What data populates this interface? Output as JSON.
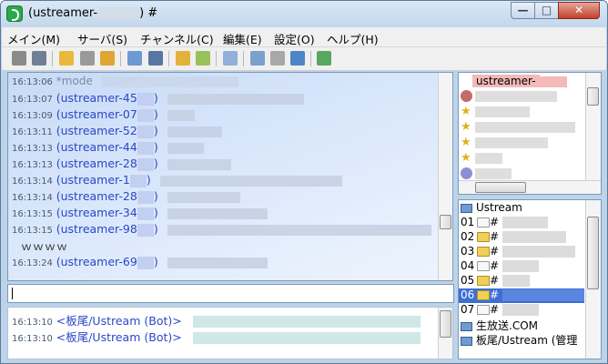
{
  "window": {
    "title_prefix": "(ustreamer-",
    "title_suffix": ") #",
    "controls": {
      "minimize": "—",
      "maximize": "□",
      "close": "✕"
    }
  },
  "menu": [
    "メイン(M)",
    "サーバ(S)",
    "チャンネル(C)",
    "編集(E)",
    "設定(O)",
    "ヘルプ(H)"
  ],
  "toolbar_icons": [
    "disconnect-icon",
    "connect-icon",
    "folder-icon",
    "save-icon",
    "open-icon",
    "monitor-icon",
    "log-icon",
    "lock-icon",
    "edit-icon",
    "checklist-icon",
    "search-icon",
    "bubble-icon",
    "globe-icon",
    "export-icon"
  ],
  "chat": {
    "lines": [
      {
        "time": "16:13:06",
        "kind": "mode",
        "text": "*mode"
      },
      {
        "time": "16:13:07",
        "kind": "msg",
        "nick": "(ustreamer-45",
        "close": ")",
        "w": 150
      },
      {
        "time": "16:13:09",
        "kind": "msg",
        "nick": "(ustreamer-07",
        "close": ")",
        "w": 30
      },
      {
        "time": "16:13:11",
        "kind": "msg",
        "nick": "(ustreamer-52",
        "close": ")",
        "w": 60
      },
      {
        "time": "16:13:13",
        "kind": "msg",
        "nick": "(ustreamer-44",
        "close": ")",
        "w": 40
      },
      {
        "time": "16:13:13",
        "kind": "msg",
        "nick": "(ustreamer-28",
        "close": ")",
        "w": 70
      },
      {
        "time": "16:13:14",
        "kind": "msg",
        "nick": "(ustreamer-1",
        "close": ")",
        "w": 200
      },
      {
        "time": "16:13:14",
        "kind": "msg",
        "nick": "(ustreamer-28",
        "close": ")",
        "w": 80
      },
      {
        "time": "16:13:15",
        "kind": "msg",
        "nick": "(ustreamer-34",
        "close": ")",
        "w": 110
      },
      {
        "time": "16:13:15",
        "kind": "msg",
        "nick": "(ustreamer-98",
        "close": ")",
        "w": 290
      },
      {
        "time": "",
        "kind": "plain",
        "text": "ｗｗｗｗ"
      },
      {
        "time": "16:13:24",
        "kind": "msg",
        "nick": "(ustreamer-69",
        "close": ")",
        "w": 110
      }
    ]
  },
  "input": {
    "value": ""
  },
  "log": {
    "lines": [
      {
        "time": "16:13:10",
        "nick": "<板尾/Ustream (Bot)>",
        "w": 250
      },
      {
        "time": "16:13:10",
        "nick": "<板尾/Ustream (Bot)>",
        "w": 250
      }
    ]
  },
  "users": {
    "selected": "ustreamer-",
    "rows": [
      {
        "icon": "user-icon",
        "w": 90
      },
      {
        "icon": "star-icon",
        "w": 60
      },
      {
        "icon": "star-icon",
        "w": 110
      },
      {
        "icon": "star-icon",
        "w": 80
      },
      {
        "icon": "star-icon",
        "w": 30
      },
      {
        "icon": "bubble-icon",
        "w": 40
      }
    ]
  },
  "channels": {
    "root": "Ustream",
    "rows": [
      {
        "num": "01",
        "folder": "white",
        "label": "#",
        "w": 50
      },
      {
        "num": "02",
        "folder": "yellow",
        "label": "#",
        "w": 70
      },
      {
        "num": "03",
        "folder": "yellow",
        "label": "#",
        "w": 80
      },
      {
        "num": "04",
        "folder": "white",
        "label": "#",
        "w": 40
      },
      {
        "num": "05",
        "folder": "yellow",
        "label": "#",
        "w": 30
      },
      {
        "num": "06",
        "folder": "yellow",
        "label": "#",
        "w": 90,
        "selected": true
      },
      {
        "num": "07",
        "folder": "white",
        "label": "#",
        "w": 40
      }
    ],
    "extra": [
      {
        "icon": "monitor-icon",
        "label": "生放送.COM"
      },
      {
        "icon": "monitor-icon",
        "label": "板尾/Ustream (管理"
      }
    ]
  }
}
